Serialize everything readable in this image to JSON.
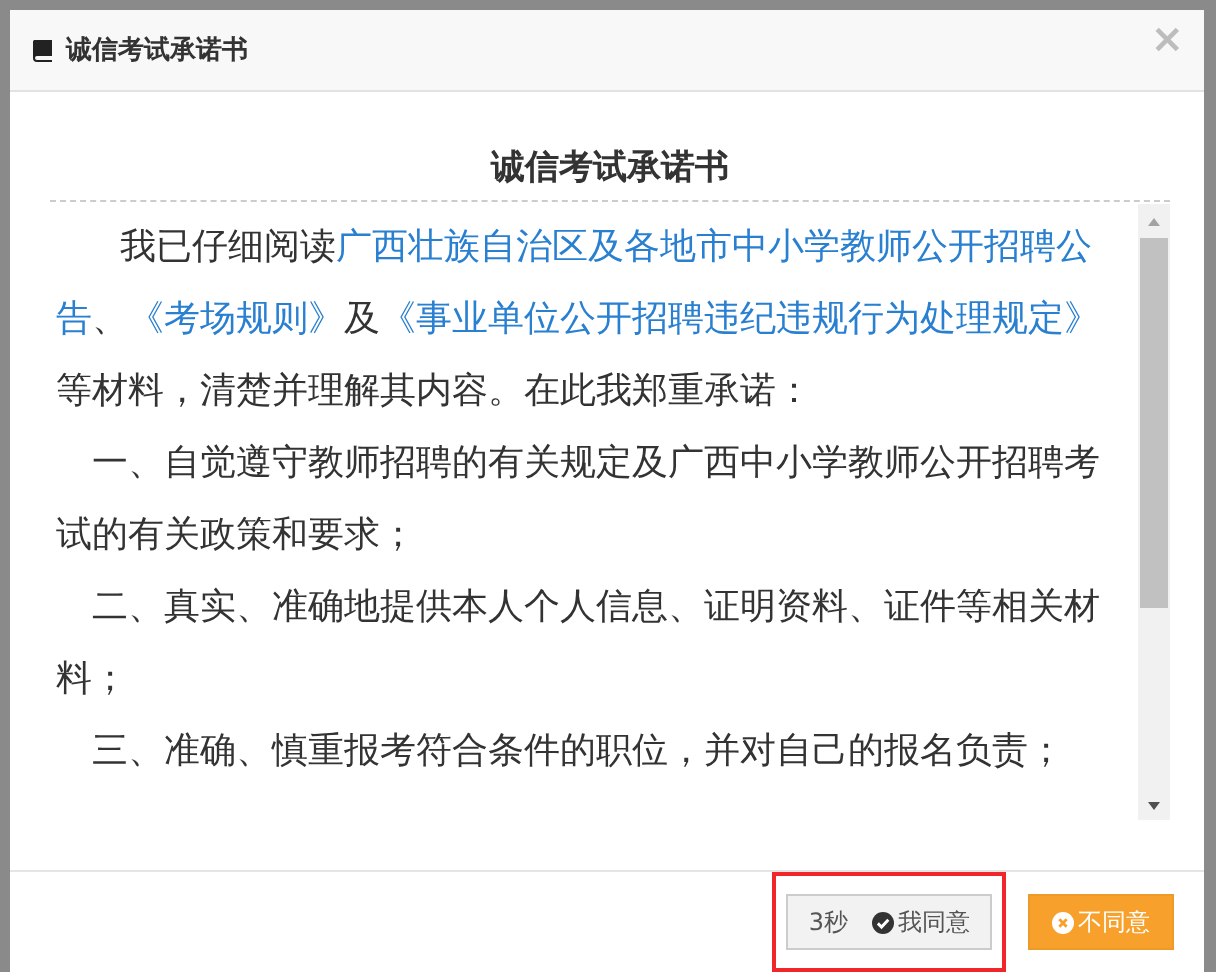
{
  "dialog": {
    "title": "诚信考试承诺书",
    "close": "×"
  },
  "document": {
    "heading": "诚信考试承诺书",
    "paragraphs": [
      {
        "kind": "intro",
        "parts": [
          {
            "text": "我已仔细阅读",
            "link": false
          },
          {
            "text": "广西壮族自治区及各地市中小学教师公开招聘公告",
            "link": true
          },
          {
            "text": "、",
            "link": false
          },
          {
            "text": "《考场规则》",
            "link": true
          },
          {
            "text": "及",
            "link": false
          },
          {
            "text": "《事业单位公开招聘违纪违规行为处理规定》",
            "link": true
          },
          {
            "text": "等材料，清楚并理解其内容。在此我郑重承诺：",
            "link": false
          }
        ]
      },
      {
        "kind": "item",
        "parts": [
          {
            "text": "一、自觉遵守教师招聘的有关规定及广西中小学教师公开招聘考试的有关政策和要求；",
            "link": false
          }
        ]
      },
      {
        "kind": "item",
        "parts": [
          {
            "text": "二、真实、准确地提供本人个人信息、证明资料、证件等相关材料；",
            "link": false
          }
        ]
      },
      {
        "kind": "item",
        "parts": [
          {
            "text": "三、准确、慎重报考符合条件的职位，并对自己的报名负责；",
            "link": false
          }
        ]
      }
    ]
  },
  "buttons": [
    {
      "kind": "agree",
      "countdown": "3秒",
      "label": "我同意",
      "disabled": true,
      "highlighted": true
    },
    {
      "kind": "disagree",
      "label": "不同意",
      "disabled": false,
      "highlighted": false
    }
  ]
}
